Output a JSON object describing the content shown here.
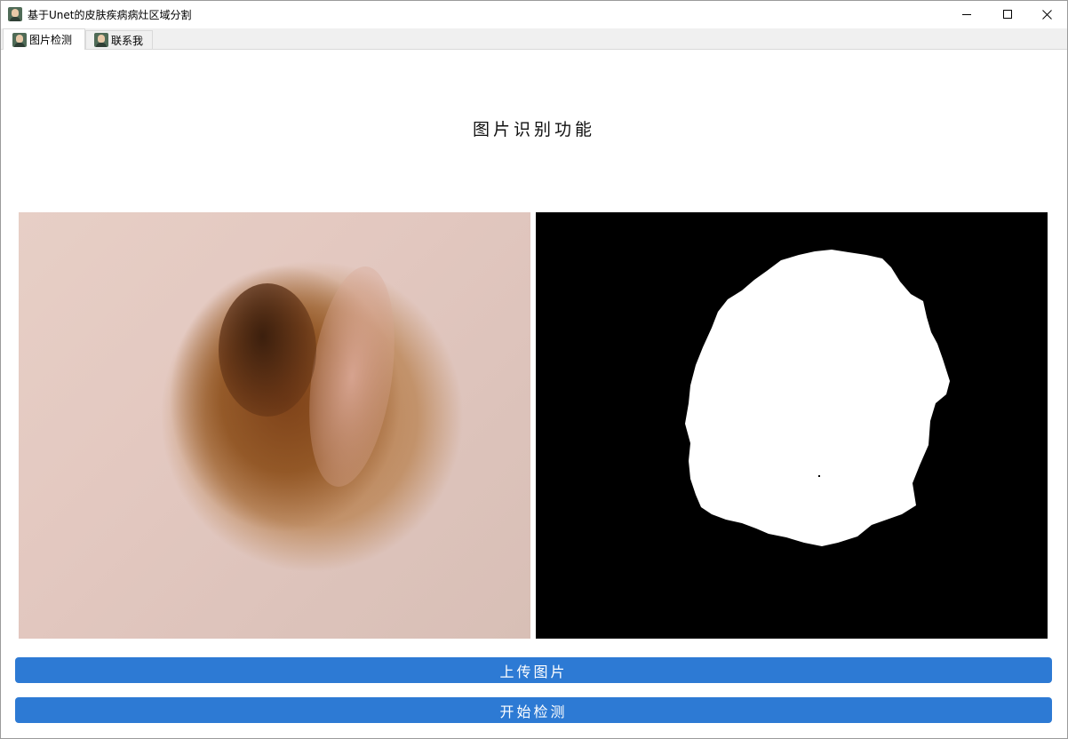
{
  "window": {
    "title": "基于Unet的皮肤疾病病灶区域分割",
    "icons": {
      "app": "portrait-icon",
      "minimize": "minimize-icon",
      "maximize": "maximize-icon",
      "close": "close-icon"
    }
  },
  "tabs": [
    {
      "label": "图片检测",
      "active": true,
      "icon": "portrait-icon"
    },
    {
      "label": "联系我",
      "active": false,
      "icon": "portrait-icon"
    }
  ],
  "main": {
    "heading": "图片识别功能",
    "images": {
      "input": "dermoscopy-skin-lesion-photo",
      "output": "binary-segmentation-mask"
    }
  },
  "buttons": {
    "upload_label": "上传图片",
    "detect_label": "开始检测"
  },
  "colors": {
    "button_bg": "#2d7ad4",
    "button_text": "#ffffff",
    "mask_bg": "#000000",
    "mask_fg": "#ffffff"
  }
}
